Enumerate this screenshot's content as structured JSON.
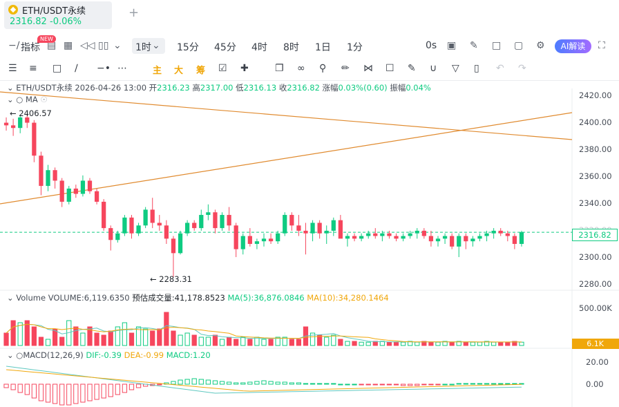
{
  "tab": {
    "title": "ETH/USDT永续",
    "price": "2316.82",
    "change": "-0.06%",
    "add_label": "+"
  },
  "toolbar": {
    "indicators_label": "指标",
    "new_badge": "NEW",
    "timeframe_selected": "1时",
    "timeframes": [
      "15分",
      "45分",
      "4时",
      "8时",
      "1日",
      "1分"
    ],
    "seconds_label": "0s",
    "ai_label": "AI解读"
  },
  "drawing_bar": {
    "chars": [
      "主",
      "大",
      "筹"
    ]
  },
  "ohlc": {
    "symbol": "ETH/USDT永续",
    "datetime": "2026-04-26 13:00",
    "open_label": "开",
    "open": "2316.23",
    "high_label": "高",
    "high": "2317.00",
    "low_label": "低",
    "low": "2316.13",
    "close_label": "收",
    "close": "2316.82",
    "change_label": "涨幅",
    "change": "0.03%(0.60)",
    "amp_label": "振幅",
    "amp": "0.04%"
  },
  "ma_label": "MA",
  "price_axis": {
    "ticks": [
      "2420.00",
      "2400.00",
      "2380.00",
      "2360.00",
      "2340.00",
      "2320.00",
      "2300.00",
      "2280.00"
    ],
    "current": "2316.82",
    "high_mark": "2406.57",
    "low_mark": "2283.31"
  },
  "volume": {
    "label": "Volume",
    "vol": "VOLUME:6,119.6350",
    "est": "预估成交量:41,178.8523",
    "ma5": "MA(5):36,876.0846",
    "ma10": "MA(10):34,280.1464",
    "axis_top": "500.00K",
    "current": "6.1K"
  },
  "macd": {
    "label": "MACD(12,26,9)",
    "dif": "DIF:-0.39",
    "dea": "DEA:-0.99",
    "macd": "MACD:1.20",
    "ticks": [
      "20.00",
      "0.00"
    ]
  },
  "colors": {
    "up": "#0ecb81",
    "down": "#f6465d",
    "accent": "#f0a70b",
    "trendline": "#e08a2e"
  },
  "chart_data": {
    "type": "candlestick",
    "ylim": [
      2276,
      2426
    ],
    "candles": [
      [
        2400,
        2404,
        2394,
        2398
      ],
      [
        2398,
        2403,
        2390,
        2396
      ],
      [
        2396,
        2406,
        2392,
        2404
      ],
      [
        2404,
        2406,
        2396,
        2400
      ],
      [
        2400,
        2402,
        2370,
        2375
      ],
      [
        2375,
        2378,
        2345,
        2352
      ],
      [
        2352,
        2368,
        2348,
        2364
      ],
      [
        2364,
        2366,
        2350,
        2356
      ],
      [
        2356,
        2358,
        2336,
        2340
      ],
      [
        2340,
        2352,
        2338,
        2350
      ],
      [
        2350,
        2353,
        2343,
        2346
      ],
      [
        2346,
        2360,
        2344,
        2356
      ],
      [
        2356,
        2358,
        2346,
        2348
      ],
      [
        2348,
        2350,
        2338,
        2340
      ],
      [
        2340,
        2342,
        2318,
        2320
      ],
      [
        2320,
        2322,
        2303,
        2311
      ],
      [
        2311,
        2318,
        2309,
        2316
      ],
      [
        2316,
        2330,
        2314,
        2328
      ],
      [
        2328,
        2330,
        2312,
        2316
      ],
      [
        2316,
        2324,
        2314,
        2322
      ],
      [
        2322,
        2336,
        2320,
        2334
      ],
      [
        2334,
        2343,
        2320,
        2324
      ],
      [
        2324,
        2330,
        2318,
        2322
      ],
      [
        2322,
        2326,
        2308,
        2312
      ],
      [
        2312,
        2314,
        2283,
        2301
      ],
      [
        2301,
        2318,
        2300,
        2316
      ],
      [
        2316,
        2326,
        2314,
        2324
      ],
      [
        2324,
        2326,
        2318,
        2320
      ],
      [
        2320,
        2334,
        2318,
        2330
      ],
      [
        2330,
        2338,
        2326,
        2332
      ],
      [
        2332,
        2334,
        2316,
        2320
      ],
      [
        2320,
        2332,
        2318,
        2330
      ],
      [
        2330,
        2336,
        2318,
        2322
      ],
      [
        2322,
        2324,
        2298,
        2304
      ],
      [
        2304,
        2316,
        2300,
        2314
      ],
      [
        2314,
        2320,
        2306,
        2308
      ],
      [
        2308,
        2312,
        2304,
        2310
      ],
      [
        2310,
        2316,
        2306,
        2312
      ],
      [
        2312,
        2316,
        2308,
        2310
      ],
      [
        2310,
        2318,
        2308,
        2316
      ],
      [
        2316,
        2332,
        2314,
        2330
      ],
      [
        2330,
        2332,
        2318,
        2322
      ],
      [
        2322,
        2330,
        2314,
        2318
      ],
      [
        2318,
        2324,
        2300,
        2316
      ],
      [
        2316,
        2326,
        2310,
        2324
      ],
      [
        2324,
        2326,
        2312,
        2316
      ],
      [
        2316,
        2322,
        2308,
        2318
      ],
      [
        2318,
        2328,
        2314,
        2326
      ],
      [
        2326,
        2330,
        2316,
        2312
      ],
      [
        2312,
        2316,
        2306,
        2314
      ],
      [
        2314,
        2316,
        2310,
        2312
      ],
      [
        2312,
        2316,
        2310,
        2314
      ],
      [
        2314,
        2318,
        2312,
        2316
      ],
      [
        2316,
        2320,
        2312,
        2314
      ],
      [
        2314,
        2318,
        2310,
        2316
      ],
      [
        2316,
        2318,
        2312,
        2314
      ],
      [
        2314,
        2316,
        2310,
        2312
      ],
      [
        2312,
        2316,
        2310,
        2314
      ],
      [
        2314,
        2318,
        2312,
        2316
      ],
      [
        2316,
        2320,
        2312,
        2318
      ],
      [
        2318,
        2320,
        2312,
        2314
      ],
      [
        2314,
        2318,
        2306,
        2310
      ],
      [
        2310,
        2314,
        2306,
        2312
      ],
      [
        2312,
        2316,
        2308,
        2314
      ],
      [
        2314,
        2316,
        2304,
        2306
      ],
      [
        2306,
        2316,
        2298,
        2314
      ],
      [
        2314,
        2316,
        2304,
        2310
      ],
      [
        2310,
        2314,
        2306,
        2312
      ],
      [
        2312,
        2316,
        2310,
        2314
      ],
      [
        2314,
        2318,
        2310,
        2316
      ],
      [
        2316,
        2320,
        2312,
        2318
      ],
      [
        2318,
        2320,
        2314,
        2316
      ],
      [
        2316,
        2318,
        2310,
        2314
      ],
      [
        2314,
        2316,
        2304,
        2308
      ],
      [
        2308,
        2318,
        2306,
        2317
      ]
    ],
    "volume": [
      30,
      60,
      55,
      60,
      45,
      20,
      15,
      40,
      20,
      60,
      45,
      30,
      45,
      30,
      25,
      35,
      45,
      55,
      30,
      45,
      40,
      35,
      40,
      80,
      35,
      25,
      30,
      25,
      20,
      20,
      25,
      15,
      20,
      15,
      20,
      15,
      20,
      15,
      15,
      20,
      20,
      15,
      15,
      45,
      30,
      25,
      20,
      25,
      15,
      10,
      10,
      8,
      8,
      10,
      10,
      8,
      8,
      8,
      10,
      8,
      10,
      8,
      8,
      10,
      8,
      10,
      8,
      8,
      8,
      10,
      8,
      8,
      8,
      10,
      8
    ],
    "macd_hist": [
      -5,
      -8,
      -12,
      -15,
      -20,
      -24,
      -26,
      -28,
      -30,
      -30,
      -28,
      -26,
      -24,
      -22,
      -20,
      -18,
      -15,
      -12,
      -8,
      -5,
      -3,
      -2,
      -1,
      2,
      4,
      6,
      7,
      8,
      7,
      6,
      5,
      4,
      3,
      2,
      2,
      3,
      4,
      5,
      4,
      3,
      3,
      2,
      2,
      1,
      1,
      1,
      1,
      1,
      0,
      0,
      0,
      -1,
      -1,
      -1,
      -1,
      -1,
      -1,
      -2,
      -2,
      -2,
      -1,
      -1,
      -1,
      0,
      0,
      1,
      1,
      1,
      1,
      1,
      1,
      1,
      1,
      1,
      1
    ]
  }
}
